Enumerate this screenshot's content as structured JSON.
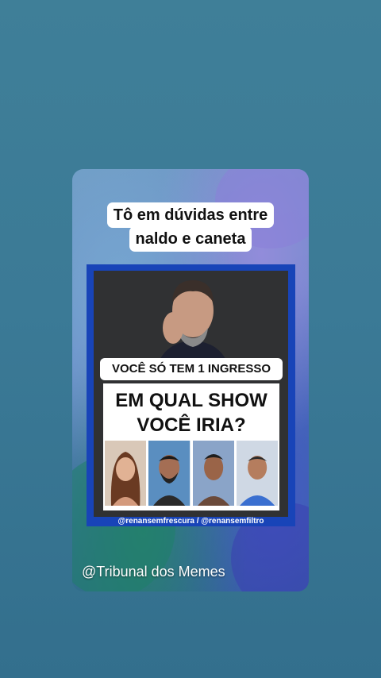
{
  "caption": {
    "line1": "Tô em dúvidas entre",
    "line2": "naldo e caneta"
  },
  "video": {
    "banner_top": "VOCÊ SÓ TEM 1 INGRESSO",
    "question_line1": "EM QUAL SHOW",
    "question_line2": "VOCÊ IRIA?",
    "handles": "@renansemfrescura  / @renansemfiltro"
  },
  "watermark": "@Tribunal dos Memes",
  "colors": {
    "frame_blue": "#1844b8",
    "page_bg": "#3b7a96"
  }
}
